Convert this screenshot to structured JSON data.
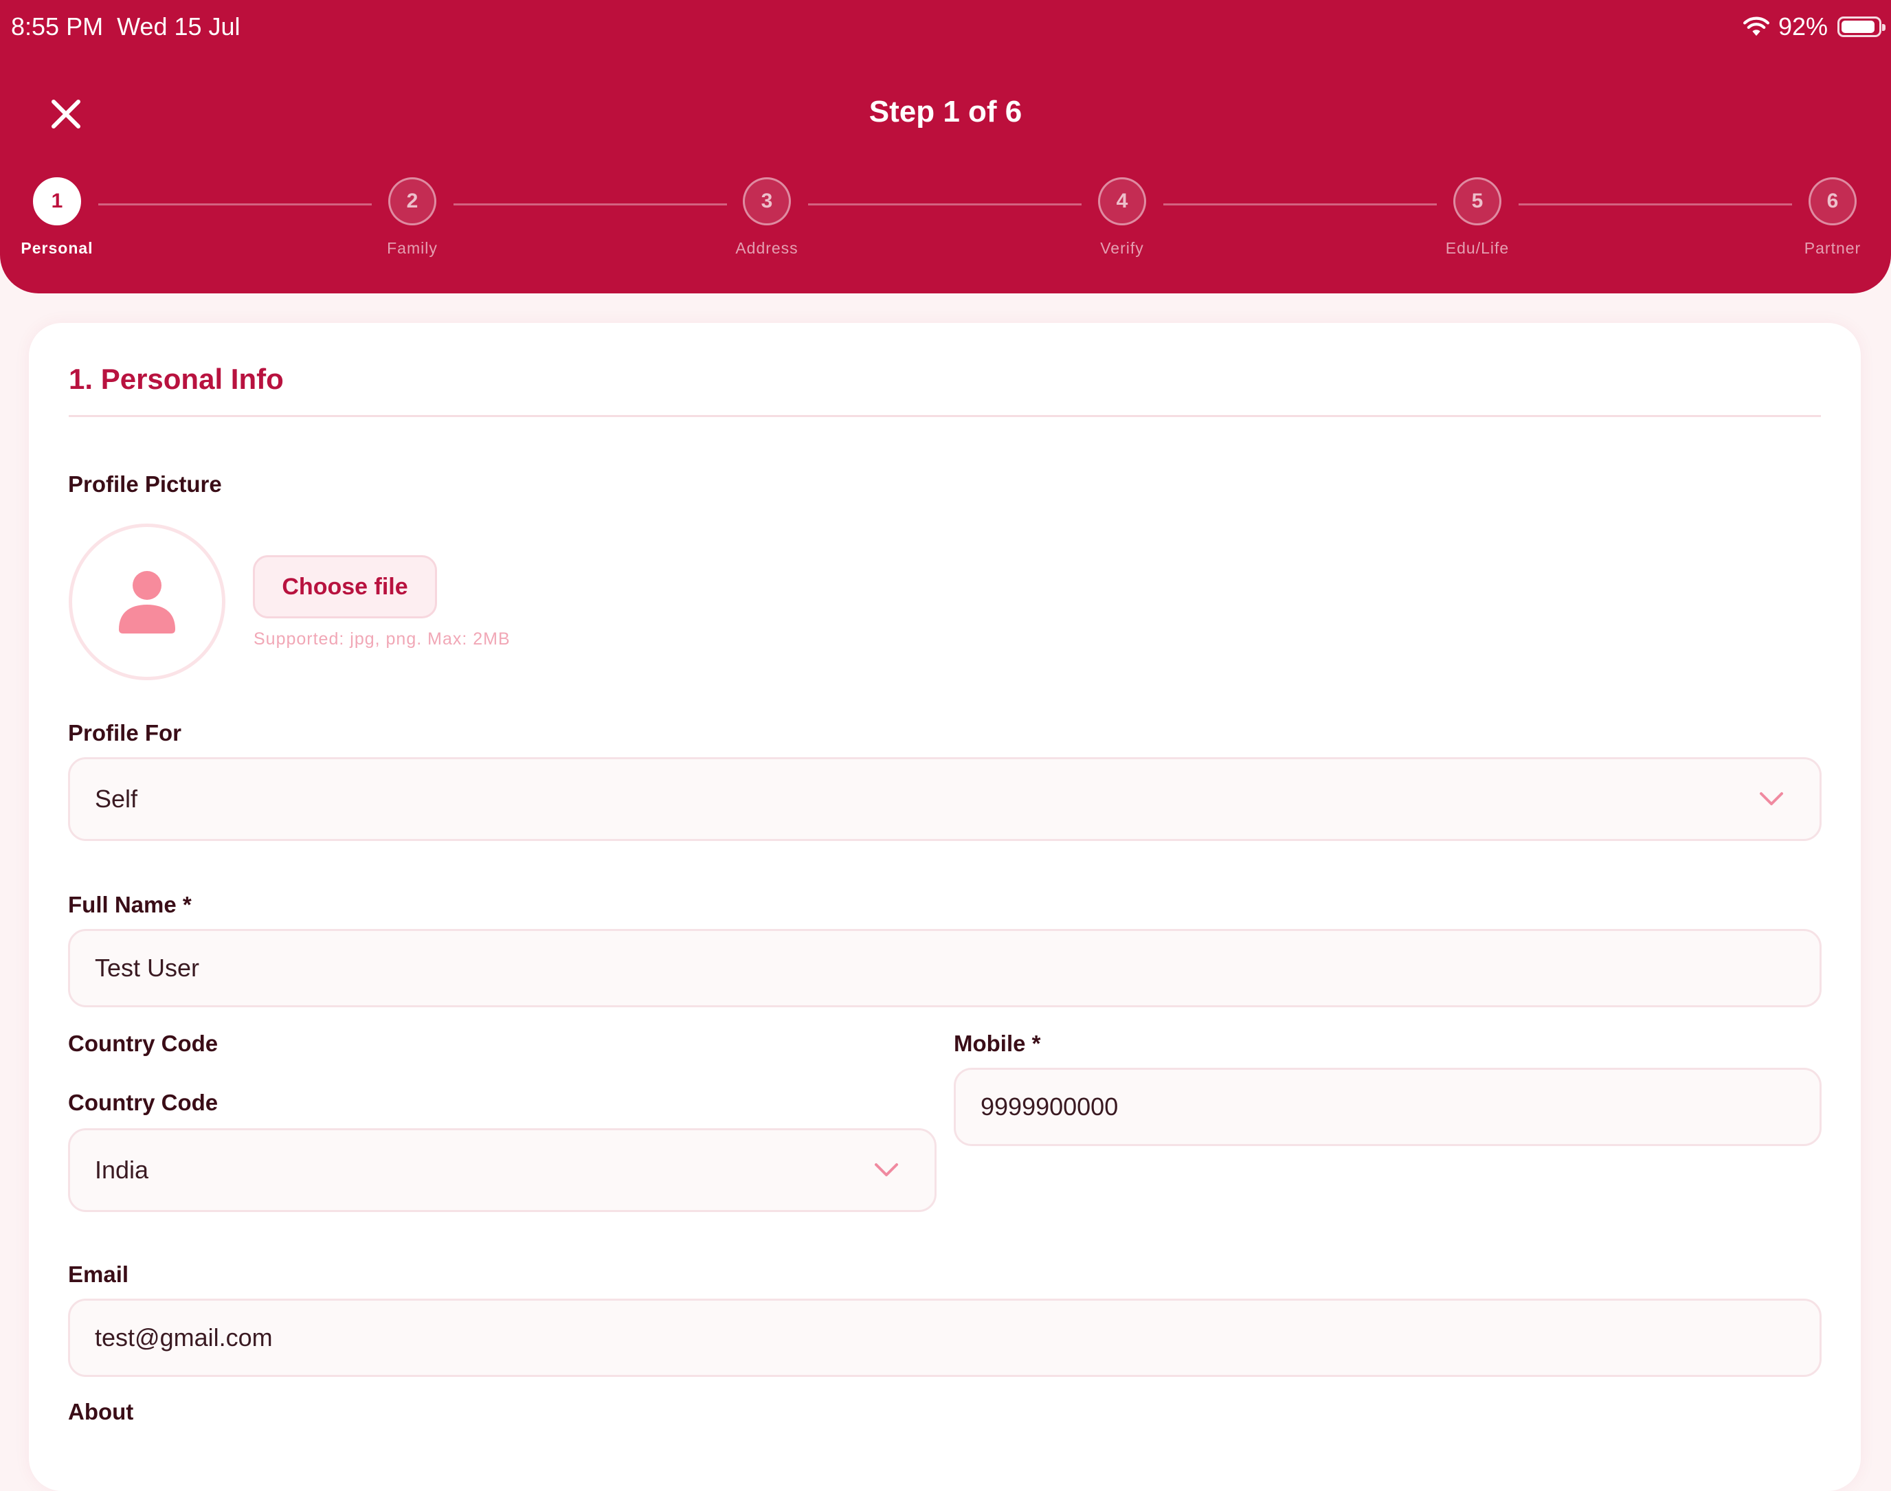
{
  "status_bar": {
    "time": "8:55 PM",
    "date": "Wed 15 Jul",
    "battery_percent": "92%",
    "battery_level": 0.92
  },
  "header": {
    "title": "Step 1 of 6"
  },
  "steps": [
    {
      "number": "1",
      "label": "Personal",
      "active": true
    },
    {
      "number": "2",
      "label": "Family",
      "active": false
    },
    {
      "number": "3",
      "label": "Address",
      "active": false
    },
    {
      "number": "4",
      "label": "Verify",
      "active": false
    },
    {
      "number": "5",
      "label": "Edu/Life",
      "active": false
    },
    {
      "number": "6",
      "label": "Partner",
      "active": false
    }
  ],
  "form": {
    "section_title": "1. Personal Info",
    "profile_picture": {
      "label": "Profile Picture",
      "button_label": "Choose file",
      "hint": "Supported: jpg, png. Max: 2MB"
    },
    "profile_for": {
      "label": "Profile For",
      "value": "Self"
    },
    "full_name": {
      "label": "Full Name *",
      "value": "Test User"
    },
    "country_code": {
      "label": "Country Code",
      "inner_label": "Country Code",
      "value": "India"
    },
    "mobile": {
      "label": "Mobile *",
      "value": "9999900000"
    },
    "email": {
      "label": "Email",
      "value": "test@gmail.com"
    },
    "about": {
      "label": "About"
    }
  },
  "colors": {
    "primary": "#bc0f3c",
    "accent_text": "#b8123f",
    "background": "#fdf3f4"
  },
  "icons": {
    "close": "close-icon",
    "avatar": "person-icon",
    "dropdown": "chevron-down-icon",
    "wifi": "wifi-icon",
    "battery": "battery-icon"
  }
}
